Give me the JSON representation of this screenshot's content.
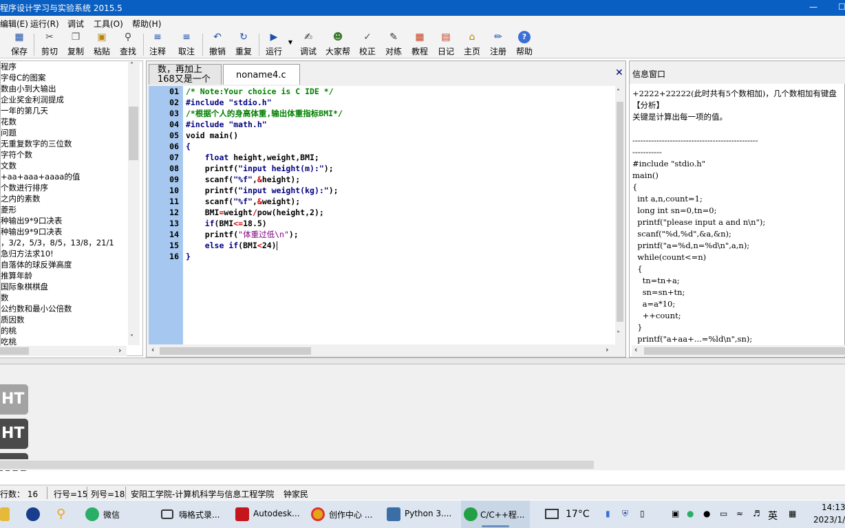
{
  "window": {
    "title": "程序设计学习与实验系统 2015.5",
    "minimize": "—",
    "maximize": "☐"
  },
  "menu": [
    "编辑(E)",
    "运行(R)",
    "调试",
    "工具(O)",
    "帮助(H)"
  ],
  "toolbar": [
    {
      "label": "保存",
      "icon": "save-icon"
    },
    {
      "label": "剪切",
      "icon": "cut-icon"
    },
    {
      "label": "复制",
      "icon": "copy-icon"
    },
    {
      "label": "粘贴",
      "icon": "paste-icon"
    },
    {
      "label": "查找",
      "icon": "find-icon"
    },
    {
      "label": "注释",
      "icon": "comment-icon"
    },
    {
      "label": "取注",
      "icon": "uncomment-icon"
    },
    {
      "label": "撤销",
      "icon": "undo-icon"
    },
    {
      "label": "重复",
      "icon": "redo-icon"
    },
    {
      "label": "运行",
      "icon": "run-icon"
    },
    {
      "label": "调试",
      "icon": "debug-icon"
    },
    {
      "label": "大家帮",
      "icon": "help-people-icon"
    },
    {
      "label": "校正",
      "icon": "check-icon"
    },
    {
      "label": "对练",
      "icon": "practice-icon"
    },
    {
      "label": "教程",
      "icon": "tutorial-icon"
    },
    {
      "label": "日记",
      "icon": "diary-icon"
    },
    {
      "label": "主页",
      "icon": "home-icon"
    },
    {
      "label": "注册",
      "icon": "register-icon"
    },
    {
      "label": "帮助",
      "icon": "help-icon"
    }
  ],
  "tree_items": [
    "程序",
    "字母C的图案",
    "数由小到大输出",
    "企业奖金利润提成",
    "一年的第几天",
    "花数",
    "问题",
    "无重复数字的三位数",
    "字符个数",
    "文数",
    "+aa+aaa+aaaa的值",
    "个数进行排序",
    "之内的素数",
    "菱形",
    "种输出9*9口决表",
    "种输出9*9口决表",
    "，3/2，5/3，8/5，13/8，21/1",
    "急归方法求10!",
    "自落体的球反弹高度",
    "推算年龄",
    "国际象棋棋盘",
    "数",
    "公约数和最小公倍数",
    "质因数",
    "的桃",
    "吃桃"
  ],
  "editor": {
    "tabs": [
      {
        "label_line1": "数，再加上",
        "label_line2": "168又是一个"
      },
      {
        "label": "noname4.c"
      }
    ],
    "close": "✕",
    "line_numbers": [
      "01",
      "02",
      "03",
      "04",
      "05",
      "06",
      "07",
      "08",
      "09",
      "10",
      "11",
      "12",
      "13",
      "14",
      "15",
      "16"
    ],
    "code": {
      "l01": "/* Note:Your choice is C IDE */",
      "l02a": "#include ",
      "l02b": "\"stdio.h\"",
      "l03": "/*根据个人的身高体重,输出体重指标BMI*/",
      "l04a": "#include ",
      "l04b": "\"math.h\"",
      "l05": "void main()",
      "l06": "{",
      "l07a": "    float",
      "l07b": " height,weight,BMI;",
      "l08a": "    printf(",
      "l08b": "\"input height(m):\"",
      "l08c": ");",
      "l09a": "    scanf(",
      "l09b": "\"%f\"",
      "l09c": ",",
      "l09d": "&",
      "l09e": "height);",
      "l10a": "    printf(",
      "l10b": "\"input weight(kg):\"",
      "l10c": ");",
      "l11a": "    scanf(",
      "l11b": "\"%f\"",
      "l11c": ",",
      "l11d": "&",
      "l11e": "weight);",
      "l12a": "    BMI",
      "l12b": "=",
      "l12c": "weight",
      "l12d": "/",
      "l12e": "pow(height,2);",
      "l13a": "    if",
      "l13b": "(BMI",
      "l13c": "<=",
      "l13d": "18.5)",
      "l14a": "    printf(",
      "l14b": "\"体重过低\\n\"",
      "l14c": ");",
      "l15a": "    else if",
      "l15b": "(BMI",
      "l15c": "<",
      "l15d": "24)",
      "l16": "}"
    }
  },
  "info": {
    "title": "信息窗口",
    "lines": [
      "+2222+22222(此时共有5个数相加)，几个数相加有键盘",
      "【分析】",
      "关键是计算出每一项的值。",
      "",
      "-----------------------------------------------",
      "-----------",
      "#include \"stdio.h\"",
      "main()",
      "{",
      "  int a,n,count=1;",
      "  long int sn=0,tn=0;",
      "  printf(\"please input a and n\\n\");",
      "  scanf(\"%d,%d\",&a,&n);",
      "  printf(\"a=%d,n=%d\\n\",a,n);",
      "  while(count<=n)",
      "  {",
      "    tn=tn+a;",
      "    sn=sn+tn;",
      "    a=a*10;",
      "    ++count;",
      "  }",
      "  printf(\"a+aa+...=%ld\\n\",sn);",
      "}"
    ]
  },
  "lower": {
    "ht_label": "HT"
  },
  "status": {
    "lines": "行数： 16",
    "row": "行号=15",
    "col": "列号=18",
    "org": "安阳工学院-计算机科学与信息工程学院",
    "author": "钟家民"
  },
  "taskbar": {
    "apps": [
      {
        "label": "微信",
        "color": "#2aae67"
      },
      {
        "label": "嗨格式录...",
        "color": "#333333"
      },
      {
        "label": "Autodesk...",
        "color": "#c4161c"
      },
      {
        "label": "创作中心 ...",
        "color": "#e6a417"
      },
      {
        "label": "Python 3....",
        "color": "#3a6ea5"
      },
      {
        "label": "C/C++程...",
        "color": "#22a045"
      }
    ],
    "weather": "17°C",
    "lang": "英",
    "time": "14:13",
    "date": "2023/1/"
  }
}
